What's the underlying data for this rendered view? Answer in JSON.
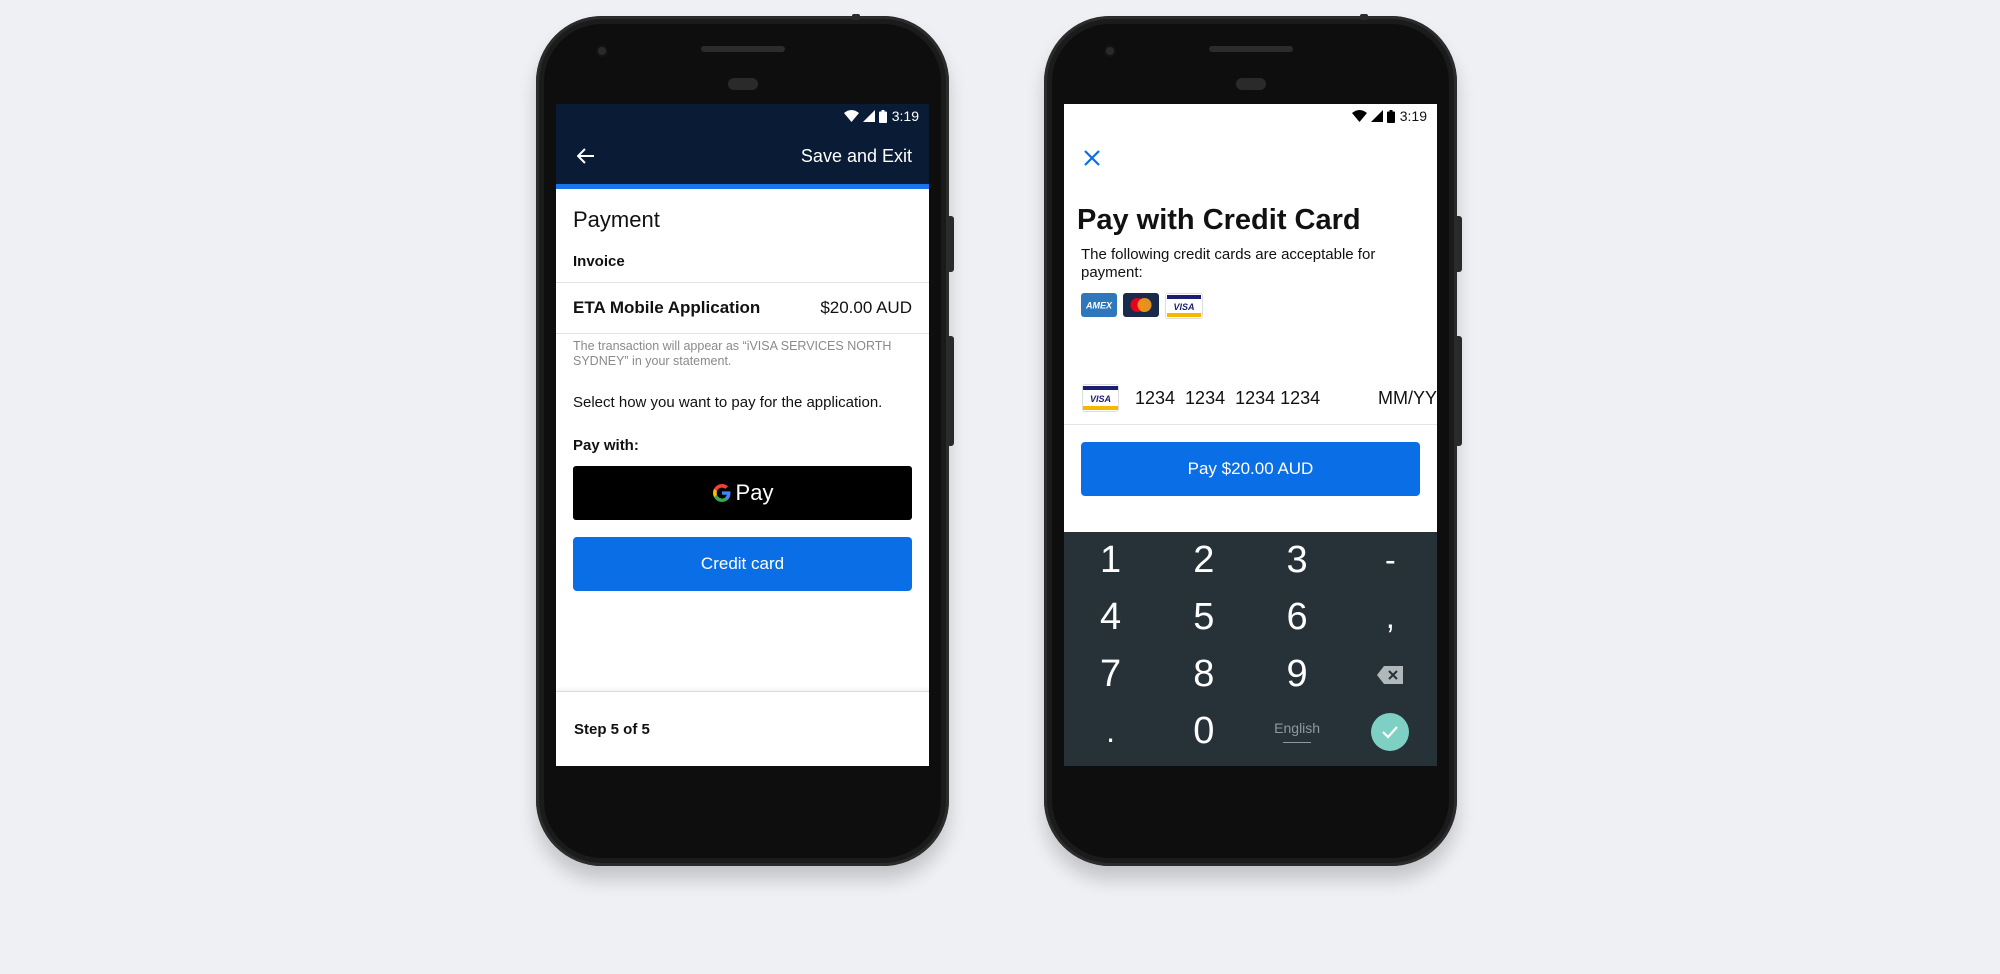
{
  "colors": {
    "header_navy": "#0a1b35",
    "primary_blue": "#0a6fe6",
    "keypad_bg": "#263238",
    "done_teal": "#7ed0c5"
  },
  "left_screen": {
    "status": {
      "time": "3:19",
      "icons": [
        "wifi-icon",
        "signal-icon",
        "battery-icon"
      ]
    },
    "header": {
      "back_icon": "arrow-left-icon",
      "save_exit": "Save and Exit"
    },
    "title": "Payment",
    "invoice_label": "Invoice",
    "invoice": {
      "item": "ETA Mobile Application",
      "amount": "$20.00 AUD"
    },
    "statement_note": "The transaction will appear as “iVISA SERVICES NORTH SYDNEY” in your statement.",
    "instruction": "Select how you want to pay for the application.",
    "pay_with_label": "Pay with:",
    "gpay_label": "Pay",
    "credit_card_label": "Credit card",
    "step": "Step 5 of 5"
  },
  "right_screen": {
    "status": {
      "time": "3:19",
      "icons": [
        "wifi-icon",
        "signal-icon",
        "battery-icon"
      ]
    },
    "close_icon": "close-icon",
    "title": "Pay with Credit Card",
    "description": "The following credit cards are acceptable for payment:",
    "brands": [
      "AMEX",
      "Mastercard",
      "VISA"
    ],
    "card_number_placeholder": "1234  1234  1234 1234",
    "expiry_placeholder": "MM/YY",
    "pay_button": "Pay $20.00 AUD",
    "keypad": {
      "rows": [
        [
          "1",
          "2",
          "3",
          "-"
        ],
        [
          "4",
          "5",
          "6",
          ","
        ],
        [
          "7",
          "8",
          "9",
          "backspace"
        ],
        [
          ".",
          "0",
          "English",
          "done"
        ]
      ]
    },
    "keys": {
      "k1": "1",
      "k2": "2",
      "k3": "3",
      "dash": "-",
      "k4": "4",
      "k5": "5",
      "k6": "6",
      "comma": ",",
      "k7": "7",
      "k8": "8",
      "k9": "9",
      "dot": ".",
      "k0": "0",
      "lang": "English"
    }
  }
}
